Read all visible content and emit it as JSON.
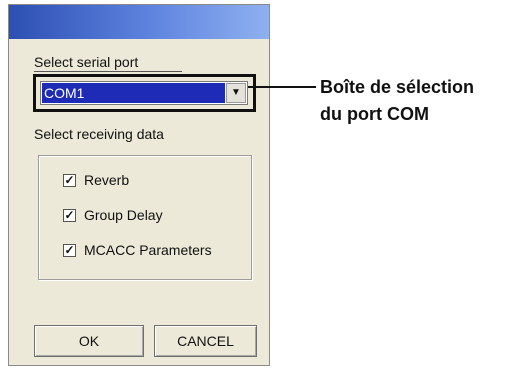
{
  "dialog": {
    "port_label": "Select serial port",
    "port_select": {
      "value": "COM1"
    },
    "receive_label": "Select receiving data",
    "options": [
      {
        "label": "Reverb",
        "checked": true
      },
      {
        "label": "Group Delay",
        "checked": true
      },
      {
        "label": "MCACC Parameters",
        "checked": true
      }
    ],
    "ok_label": "OK",
    "cancel_label": "CANCEL"
  },
  "callout": {
    "line1": "Boîte de sélection",
    "line2": "du port COM"
  },
  "icons": {
    "dropdown": "chevron-down-icon",
    "checkbox": "checkmark-icon"
  }
}
